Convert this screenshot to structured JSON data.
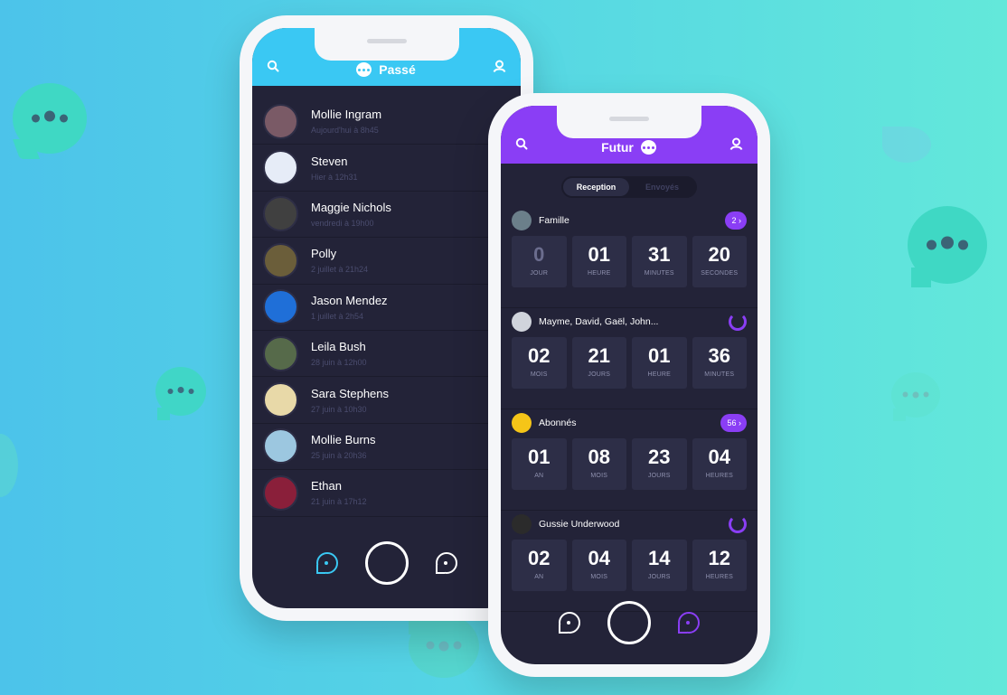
{
  "phone_left": {
    "title": "Passé",
    "contacts": [
      {
        "name": "Mollie Ingram",
        "time": "Aujourd'hui à 8h45",
        "color": "#7a5a66"
      },
      {
        "name": "Steven",
        "time": "Hier à 12h31",
        "color": "#e6ecf7"
      },
      {
        "name": "Maggie Nichols",
        "time": "vendredi à 19h00",
        "color": "#404040"
      },
      {
        "name": "Polly",
        "time": "2 juillet à 21h24",
        "color": "#6b5e3a"
      },
      {
        "name": "Jason Mendez",
        "time": "1 juillet à 2h54",
        "color": "#1f6fd8"
      },
      {
        "name": "Leila Bush",
        "time": "28 juin à 12h00",
        "color": "#566a4a"
      },
      {
        "name": "Sara Stephens",
        "time": "27 juin à 10h30",
        "color": "#e8d9a8"
      },
      {
        "name": "Mollie Burns",
        "time": "25 juin à 20h36",
        "color": "#9cc7e0"
      },
      {
        "name": "Ethan",
        "time": "21 juin à 17h12",
        "color": "#8a1f3a"
      }
    ]
  },
  "phone_right": {
    "title": "Futur",
    "tabs": [
      "Reception",
      "Envoyés"
    ],
    "groups": [
      {
        "name": "Famille",
        "badge": "2 ›",
        "avatar_color": "#6b7f8a",
        "cells": [
          {
            "v": "0",
            "u": "JOUR"
          },
          {
            "v": "01",
            "u": "HEURE"
          },
          {
            "v": "31",
            "u": "MINUTES"
          },
          {
            "v": "20",
            "u": "SECONDES"
          }
        ]
      },
      {
        "name": "Mayme, David, Gaël, John...",
        "badge": "",
        "avatar_color": "#d0d4dc",
        "cells": [
          {
            "v": "02",
            "u": "MOIS"
          },
          {
            "v": "21",
            "u": "JOURS"
          },
          {
            "v": "01",
            "u": "HEURE"
          },
          {
            "v": "36",
            "u": "MINUTES"
          }
        ]
      },
      {
        "name": "Abonnés",
        "badge": "56 ›",
        "avatar_color": "#f5c518",
        "cells": [
          {
            "v": "01",
            "u": "AN"
          },
          {
            "v": "08",
            "u": "MOIS"
          },
          {
            "v": "23",
            "u": "JOURS"
          },
          {
            "v": "04",
            "u": "HEURES"
          }
        ]
      },
      {
        "name": "Gussie Underwood",
        "badge": "",
        "avatar_color": "#2b2b2b",
        "cells": [
          {
            "v": "02",
            "u": "AN"
          },
          {
            "v": "04",
            "u": "MOIS"
          },
          {
            "v": "14",
            "u": "JOURS"
          },
          {
            "v": "12",
            "u": "HEURES"
          }
        ]
      }
    ]
  },
  "colors": {
    "accent_blue": "#3ac8f3",
    "accent_purple": "#8a3ef5",
    "screen_bg": "#232338"
  }
}
